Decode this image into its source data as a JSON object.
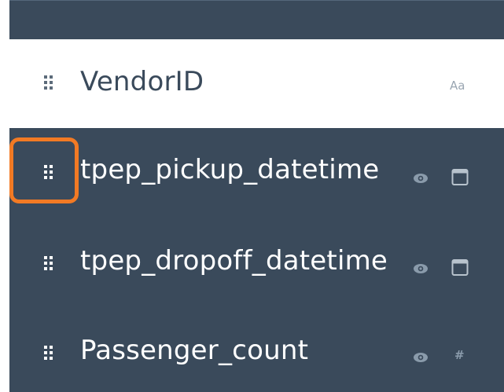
{
  "columns": [
    {
      "name": "VendorID",
      "type_label": "Aa",
      "type_icon": "text-type-icon",
      "visible": true,
      "style": "light"
    },
    {
      "name": "tpep_pickup_datetime",
      "type_icon": "calendar-icon",
      "visible_icon": "eye-icon",
      "style": "dark",
      "highlighted": true
    },
    {
      "name": "tpep_dropoff_datetime",
      "type_icon": "calendar-icon",
      "visible_icon": "eye-icon",
      "style": "dark"
    },
    {
      "name": "Passenger_count",
      "type_label": "#",
      "type_icon": "number-type-icon",
      "visible_icon": "eye-icon",
      "style": "dark"
    }
  ],
  "colors": {
    "panel_dark": "#3a4a5b",
    "panel_light": "#ffffff",
    "highlight": "#f27a24"
  }
}
